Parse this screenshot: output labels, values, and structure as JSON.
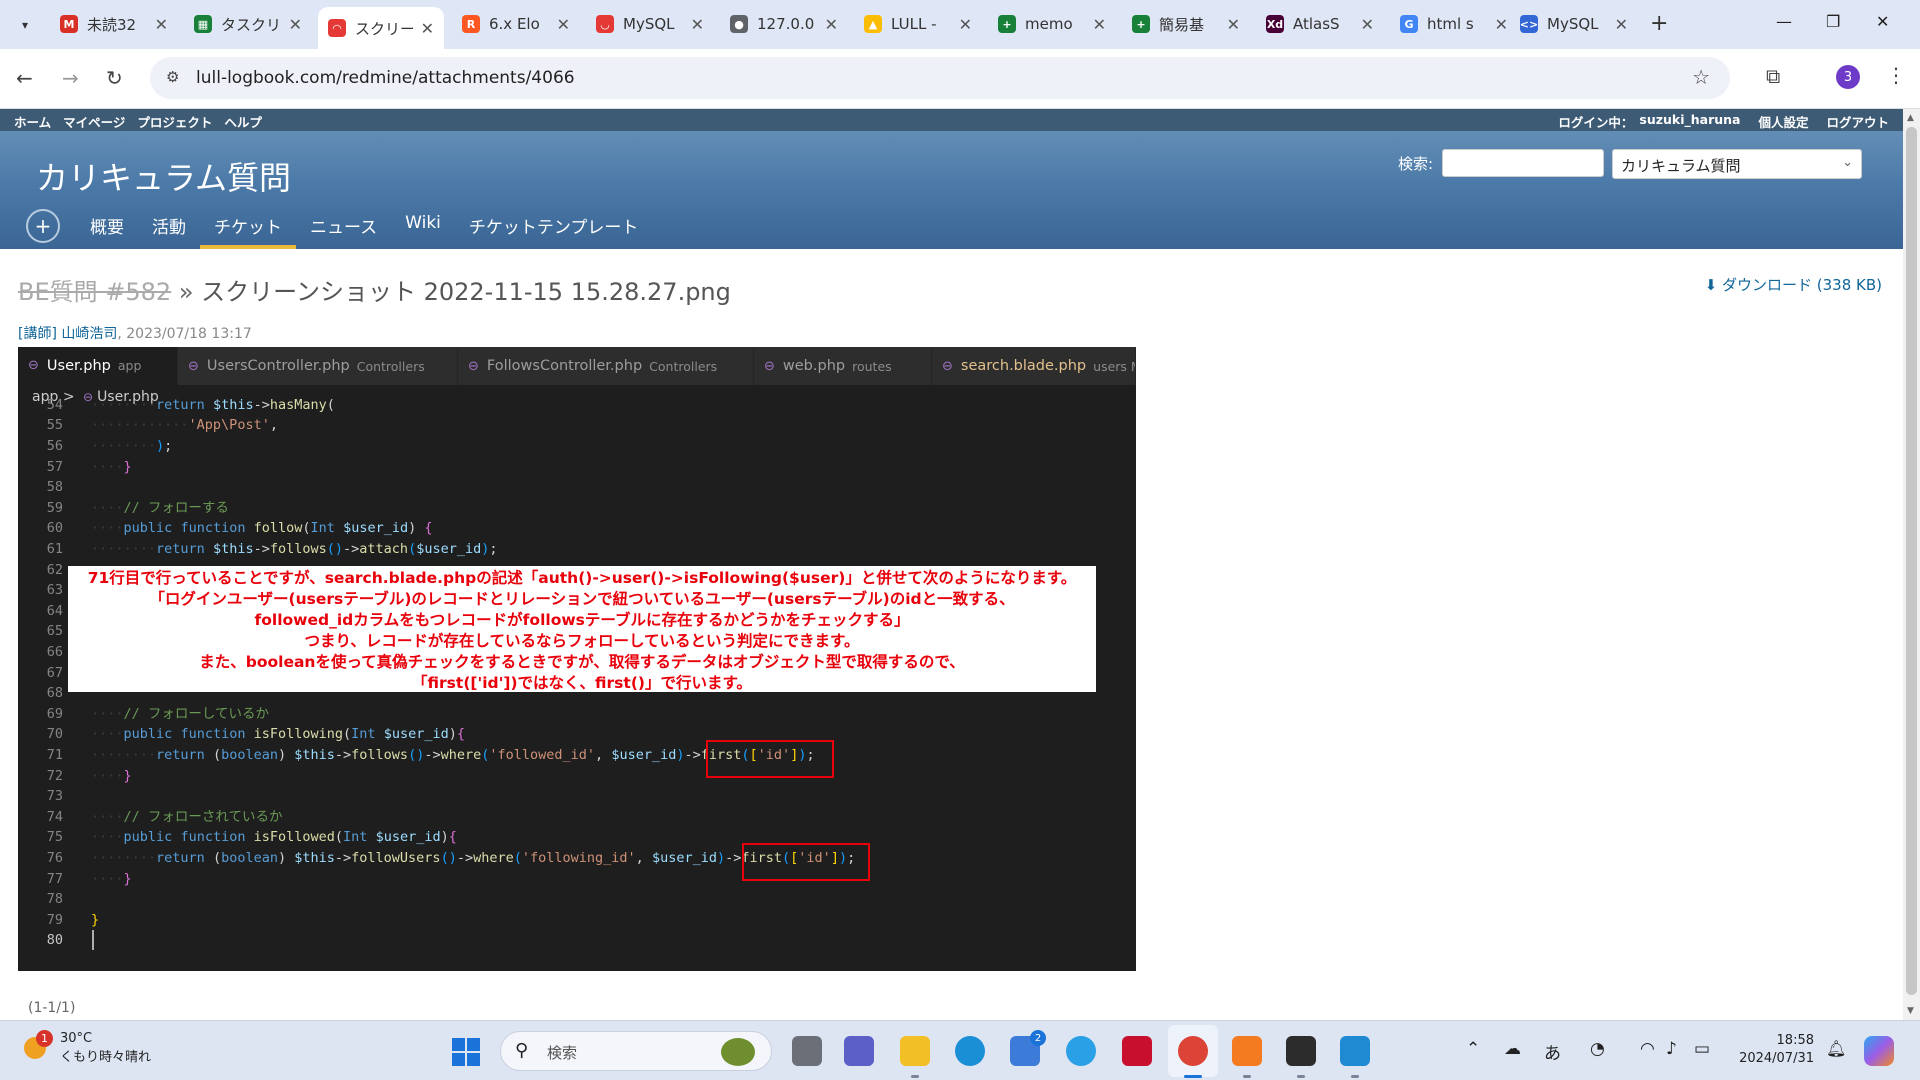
{
  "browser": {
    "tabs": [
      {
        "title": "未読32",
        "color": "#d93025",
        "glyph": "M"
      },
      {
        "title": "タスクリ",
        "color": "#188038",
        "glyph": "▦"
      },
      {
        "title": "スクリー",
        "color": "#e53935",
        "glyph": "◠",
        "active": true
      },
      {
        "title": "6.x Elo",
        "color": "#ff5722",
        "glyph": "R"
      },
      {
        "title": "MySQL",
        "color": "#e53935",
        "glyph": "◡"
      },
      {
        "title": "127.0.0",
        "color": "#5f6368",
        "glyph": "●"
      },
      {
        "title": "LULL -",
        "color": "#fbbc04",
        "glyph": "▲"
      },
      {
        "title": "memo",
        "color": "#188038",
        "glyph": "+"
      },
      {
        "title": "簡易基",
        "color": "#188038",
        "glyph": "+"
      },
      {
        "title": "AtlasS",
        "color": "#470137",
        "glyph": "Xd"
      },
      {
        "title": "html s",
        "color": "#4285f4",
        "glyph": "G"
      },
      {
        "title": "MySQL",
        "color": "#3367d6",
        "glyph": "<>"
      }
    ],
    "url": "lull-logbook.com/redmine/attachments/4066",
    "profile_initial": "3"
  },
  "redmine": {
    "top_menu": [
      "ホーム",
      "マイページ",
      "プロジェクト",
      "ヘルプ"
    ],
    "logged_in_label": "ログイン中：",
    "username": "suzuki_haruna",
    "account_links": [
      "個人設定",
      "ログアウト"
    ],
    "project_title": "カリキュラム質問",
    "search_label": "検索:",
    "search_value": "",
    "project_jump": "カリキュラム質問",
    "main_menu": [
      "概要",
      "活動",
      "チケット",
      "ニュース",
      "Wiki",
      "チケットテンプレート"
    ],
    "selected_menu": "チケット",
    "issue_link": "BE質問 #582",
    "title_sep": "»",
    "file_name": "スクリーンショット 2022-11-15 15.28.27.png",
    "download_label": "ダウンロード (338 KB)",
    "author": "[講師] 山崎浩司",
    "date": ", 2023/07/18 13:17",
    "pagination": "(1-1/1)"
  },
  "screenshot": {
    "tabs": [
      {
        "name": "User.php",
        "dir": "app",
        "active": true
      },
      {
        "name": "UsersController.php",
        "dir": "Controllers"
      },
      {
        "name": "FollowsController.php",
        "dir": "Controllers"
      },
      {
        "name": "web.php",
        "dir": "routes"
      },
      {
        "name": "search.blade.php",
        "dir": "users M",
        "modified": true
      }
    ],
    "breadcrumb": {
      "folder": "app",
      "sep": ">",
      "file": "User.php"
    },
    "annotation": [
      "71行目で行っていることですが、search.blade.phpの記述「auth()->user()->isFollowing($user)」と併せて次のようになります。",
      "「ログインユーザー(usersテーブル)のレコードとリレーションで紐ついているユーザー(usersテーブル)のidと一致する、",
      "followed_idカラムをもつレコードがfollowsテーブルに存在するかどうかをチェックする」",
      "つまり、レコードが存在しているならフォローしているという判定にできます。",
      "また、booleanを使って真偽チェックをするときですが、取得するデータはオブジェクト型で取得するので、",
      "「first(['id'])ではなく、first()」で行います。"
    ]
  },
  "taskbar": {
    "weather_temp": "30°C",
    "weather_desc": "くもり時々晴れ",
    "weather_badge": "1",
    "search_placeholder": "検索",
    "ime": "あ",
    "time": "18:58",
    "date": "2024/07/31",
    "store_badge": "2"
  }
}
